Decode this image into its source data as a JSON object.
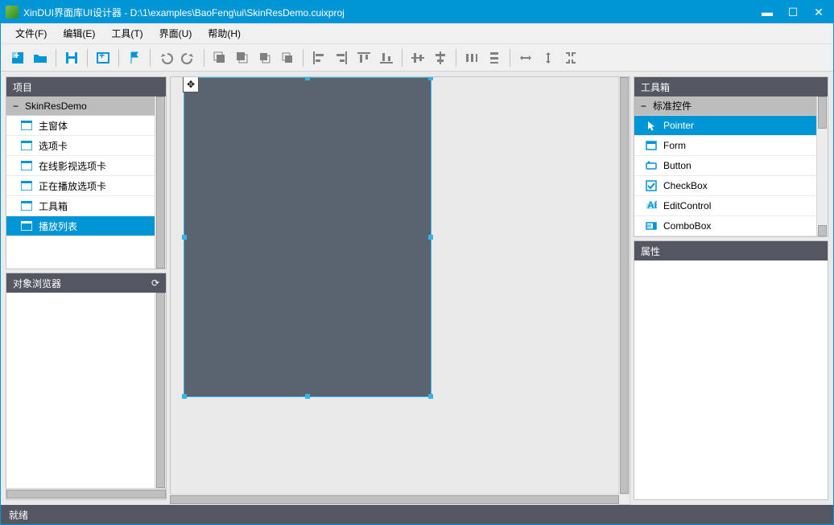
{
  "title": "XinDUI界面库UI设计器 - D:\\1\\examples\\BaoFeng\\ui\\SkinResDemo.cuixproj",
  "menus": {
    "file": "文件(F)",
    "edit": "编辑(E)",
    "tools": "工具(T)",
    "ui": "界面(U)",
    "help": "帮助(H)"
  },
  "panels": {
    "project": "项目",
    "browser": "对象浏览器",
    "toolbox": "工具箱",
    "props": "属性"
  },
  "project": {
    "root": "SkinResDemo",
    "items": [
      "主窗体",
      "选项卡",
      "在线影视选项卡",
      "正在播放选项卡",
      "工具箱",
      "播放列表"
    ],
    "selectedIndex": 5
  },
  "toolbox": {
    "root": "标准控件",
    "items": [
      "Pointer",
      "Form",
      "Button",
      "CheckBox",
      "EditControl",
      "ComboBox"
    ],
    "selectedIndex": 0
  },
  "status": "就绪",
  "colors": {
    "accent": "#0096d6",
    "panelHeader": "#545761",
    "canvasObj": "#5a6470"
  }
}
